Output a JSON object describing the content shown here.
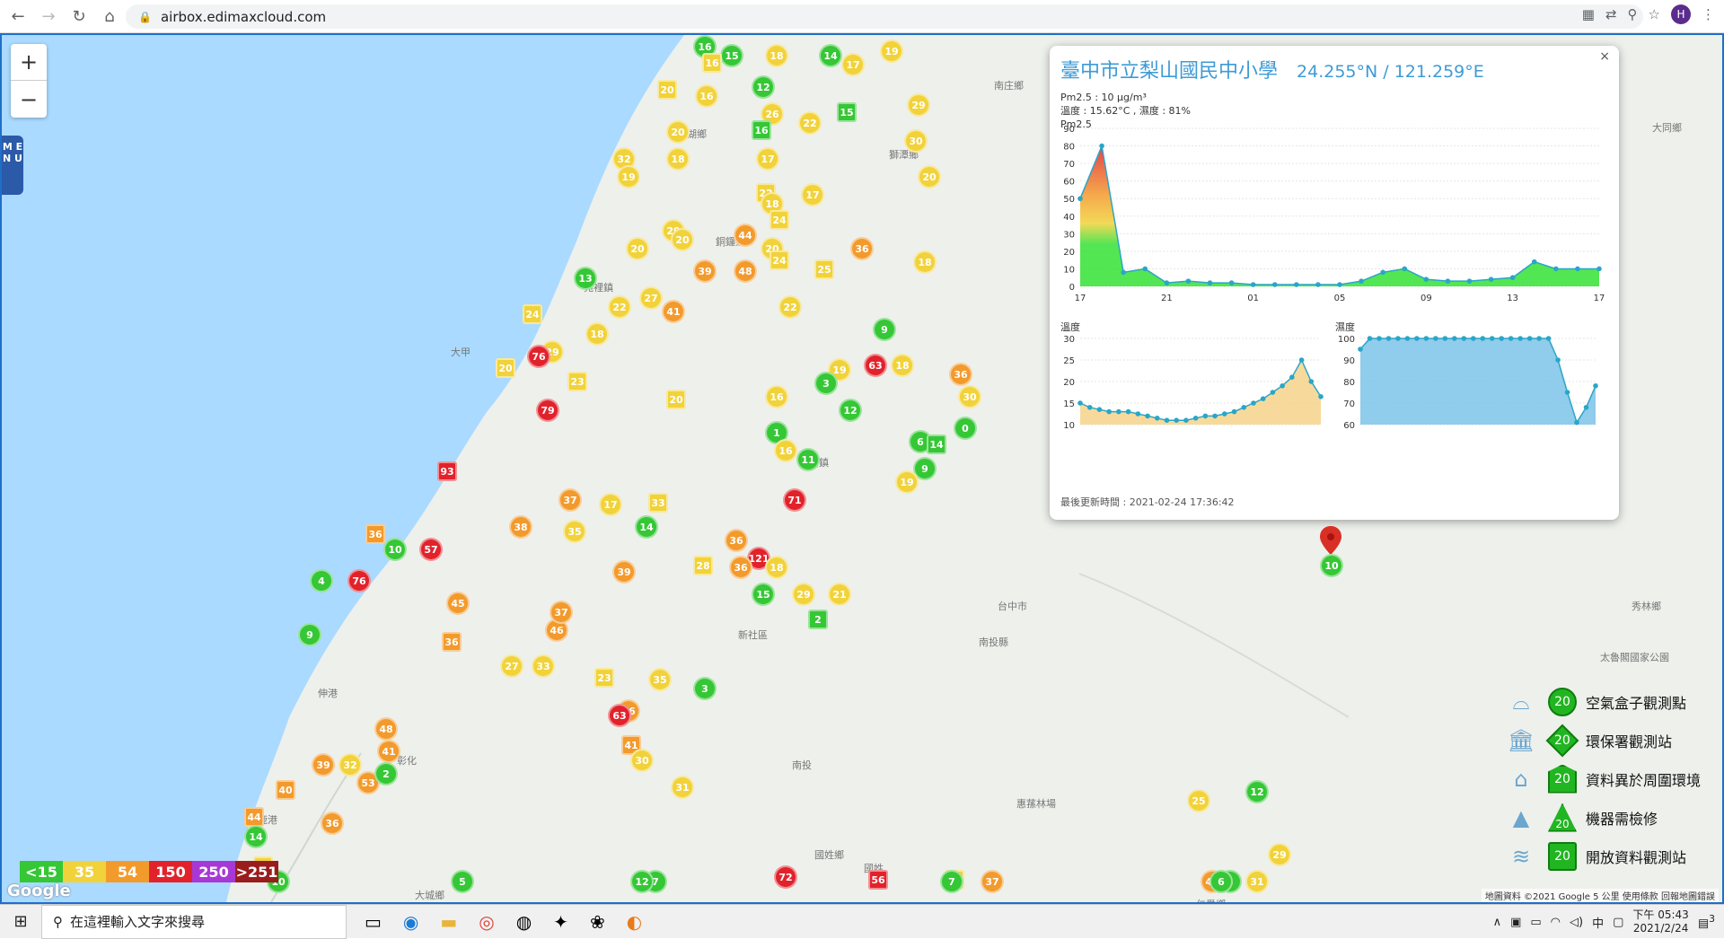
{
  "browser": {
    "url": "airbox.edimaxcloud.com",
    "avatar_letter": "H"
  },
  "map": {
    "zoom_in": "+",
    "zoom_out": "−",
    "menu_label": "M E N U",
    "places": [
      "南庄鄉",
      "大同鄉",
      "獅潭鄉",
      "西湖鄉",
      "銅鑼鄉",
      "苑裡鎮",
      "卓蘭鎮",
      "大甲",
      "台中市",
      "新社區",
      "南投縣",
      "惠蓀林場",
      "國姓鄉",
      "鹿港",
      "伸港",
      "秀林鄉",
      "太魯閣國家公園",
      "南投",
      "彰化",
      "大城鄉",
      "國姓",
      "仁愛鄉"
    ]
  },
  "popup": {
    "close": "×",
    "title": "臺中市立梨山國民中小學",
    "coord": "24.255°N / 121.259°E",
    "pm25_line": "Pm2.5 : 10 μg/m³",
    "temp_hum_line": "溫度 : 15.62°C , 濕度 : 81%",
    "pm25_label": "Pm2.5",
    "temp_label": "溫度",
    "hum_label": "濕度",
    "update": "最後更新時間 : 2021-02-24 17:36:42"
  },
  "chart_data": [
    {
      "type": "area",
      "title": "Pm2.5",
      "x": [
        "17",
        "18",
        "19",
        "20",
        "21",
        "22",
        "23",
        "00",
        "01",
        "02",
        "03",
        "04",
        "05",
        "06",
        "07",
        "08",
        "09",
        "10",
        "11",
        "12",
        "13",
        "14",
        "15",
        "16",
        "17"
      ],
      "tick_labels": [
        "17",
        "21",
        "01",
        "05",
        "09",
        "13",
        "17"
      ],
      "values": [
        50,
        80,
        8,
        10,
        2,
        3,
        2,
        2,
        1,
        1,
        1,
        1,
        1,
        3,
        8,
        10,
        4,
        3,
        3,
        4,
        5,
        14,
        10,
        10,
        10
      ],
      "ylim": [
        0,
        90
      ],
      "yticks": [
        0,
        10,
        20,
        30,
        40,
        50,
        60,
        70,
        80,
        90
      ]
    },
    {
      "type": "area",
      "title": "溫度",
      "values": [
        15,
        14,
        13.5,
        13,
        13,
        13,
        12.5,
        12,
        11.5,
        11,
        11,
        11,
        11.5,
        12,
        12,
        12.5,
        13,
        14,
        15,
        16,
        17.5,
        19,
        21,
        25,
        20,
        16.5
      ],
      "ylim": [
        10,
        30
      ],
      "yticks": [
        10,
        15,
        20,
        25,
        30
      ]
    },
    {
      "type": "area",
      "title": "濕度",
      "values": [
        95,
        100,
        100,
        100,
        100,
        100,
        100,
        100,
        100,
        100,
        100,
        100,
        100,
        100,
        100,
        100,
        100,
        100,
        100,
        100,
        100,
        90,
        75,
        61,
        68,
        78
      ],
      "ylim": [
        60,
        100
      ],
      "yticks": [
        60,
        70,
        80,
        90,
        100
      ]
    }
  ],
  "legend": [
    {
      "badge": "20",
      "label": "空氣盒子觀測點"
    },
    {
      "badge": "20",
      "label": "環保署觀測站"
    },
    {
      "badge": "20",
      "label": "資料異於周圍環境"
    },
    {
      "badge": "20",
      "label": "機器需檢修"
    },
    {
      "badge": "20",
      "label": "開放資料觀測站"
    }
  ],
  "scale": [
    {
      "label": "<15",
      "color": "#35c735"
    },
    {
      "label": "35",
      "color": "#f1d23a"
    },
    {
      "label": "54",
      "color": "#f39a2c"
    },
    {
      "label": "150",
      "color": "#e2222b"
    },
    {
      "label": "250",
      "color": "#a838d6"
    },
    {
      "label": ">251",
      "color": "#9a1d1d"
    }
  ],
  "google": "Google",
  "attrib": "地圖資料 ©2021 Google   5 公里        使用條款   回報地圖錯誤",
  "markers": [
    {
      "v": "16",
      "c": "#35c735"
    },
    {
      "v": "15",
      "c": "#35c735"
    },
    {
      "v": "16",
      "c": "#f1d23a"
    },
    {
      "v": "18",
      "c": "#f1d23a"
    },
    {
      "v": "14",
      "c": "#35c735"
    },
    {
      "v": "17",
      "c": "#f1d23a"
    },
    {
      "v": "19",
      "c": "#f1d23a"
    },
    {
      "v": "20",
      "c": "#f1d23a"
    },
    {
      "v": "16",
      "c": "#f1d23a"
    },
    {
      "v": "12",
      "c": "#35c735"
    },
    {
      "v": "26",
      "c": "#f1d23a"
    },
    {
      "v": "22",
      "c": "#f1d23a"
    },
    {
      "v": "15",
      "c": "#35c735"
    },
    {
      "v": "32",
      "c": "#f1d23a"
    },
    {
      "v": "20",
      "c": "#f1d23a"
    },
    {
      "v": "19",
      "c": "#f1d23a"
    },
    {
      "v": "18",
      "c": "#f1d23a"
    },
    {
      "v": "16",
      "c": "#35c735"
    },
    {
      "v": "17",
      "c": "#f1d23a"
    },
    {
      "v": "29",
      "c": "#f1d23a"
    },
    {
      "v": "30",
      "c": "#f1d23a"
    },
    {
      "v": "20",
      "c": "#f1d23a"
    },
    {
      "v": "22",
      "c": "#f1d23a"
    },
    {
      "v": "17",
      "c": "#f1d23a"
    },
    {
      "v": "29",
      "c": "#f1d23a"
    },
    {
      "v": "20",
      "c": "#f1d23a"
    },
    {
      "v": "18",
      "c": "#f1d23a"
    },
    {
      "v": "24",
      "c": "#f1d23a"
    },
    {
      "v": "20",
      "c": "#f1d23a"
    },
    {
      "v": "39",
      "c": "#f39a2c"
    },
    {
      "v": "44",
      "c": "#f39a2c"
    },
    {
      "v": "20",
      "c": "#f1d23a"
    },
    {
      "v": "24",
      "c": "#f1d23a"
    },
    {
      "v": "48",
      "c": "#f39a2c"
    },
    {
      "v": "36",
      "c": "#f39a2c"
    },
    {
      "v": "18",
      "c": "#f1d23a"
    },
    {
      "v": "22",
      "c": "#f1d23a"
    },
    {
      "v": "25",
      "c": "#f1d23a"
    },
    {
      "v": "13",
      "c": "#35c735"
    },
    {
      "v": "22",
      "c": "#f1d23a"
    },
    {
      "v": "27",
      "c": "#f1d23a"
    },
    {
      "v": "41",
      "c": "#f39a2c"
    },
    {
      "v": "24",
      "c": "#f1d23a"
    },
    {
      "v": "29",
      "c": "#f1d23a"
    },
    {
      "v": "18",
      "c": "#f1d23a"
    },
    {
      "v": "79",
      "c": "#e2222b"
    },
    {
      "v": "76",
      "c": "#e2222b"
    },
    {
      "v": "23",
      "c": "#f1d23a"
    },
    {
      "v": "19",
      "c": "#f1d23a"
    },
    {
      "v": "9",
      "c": "#35c735"
    },
    {
      "v": "63",
      "c": "#e2222b"
    },
    {
      "v": "18",
      "c": "#f1d23a"
    },
    {
      "v": "20",
      "c": "#f1d23a"
    },
    {
      "v": "12",
      "c": "#35c735"
    },
    {
      "v": "3",
      "c": "#35c735"
    },
    {
      "v": "30",
      "c": "#f1d23a"
    },
    {
      "v": "0",
      "c": "#35c735"
    },
    {
      "v": "20",
      "c": "#f1d23a"
    },
    {
      "v": "36",
      "c": "#f39a2c"
    },
    {
      "v": "1",
      "c": "#35c735"
    },
    {
      "v": "16",
      "c": "#f1d23a"
    },
    {
      "v": "6",
      "c": "#35c735"
    },
    {
      "v": "14",
      "c": "#35c735"
    },
    {
      "v": "16",
      "c": "#f1d23a"
    },
    {
      "v": "9",
      "c": "#35c735"
    },
    {
      "v": "11",
      "c": "#35c735"
    },
    {
      "v": "19",
      "c": "#f1d23a"
    },
    {
      "v": "93",
      "c": "#e2222b"
    },
    {
      "v": "71",
      "c": "#e2222b"
    },
    {
      "v": "37",
      "c": "#f39a2c"
    },
    {
      "v": "35",
      "c": "#f1d23a"
    },
    {
      "v": "17",
      "c": "#f1d23a"
    },
    {
      "v": "33",
      "c": "#f1d23a"
    },
    {
      "v": "14",
      "c": "#35c735"
    },
    {
      "v": "38",
      "c": "#f39a2c"
    },
    {
      "v": "36",
      "c": "#f39a2c"
    },
    {
      "v": "121",
      "c": "#e2222b"
    },
    {
      "v": "36",
      "c": "#f39a2c"
    },
    {
      "v": "10",
      "c": "#35c735"
    },
    {
      "v": "57",
      "c": "#e2222b"
    },
    {
      "v": "39",
      "c": "#f39a2c"
    },
    {
      "v": "36",
      "c": "#f39a2c"
    },
    {
      "v": "28",
      "c": "#f1d23a"
    },
    {
      "v": "18",
      "c": "#f1d23a"
    },
    {
      "v": "15",
      "c": "#35c735"
    },
    {
      "v": "29",
      "c": "#f1d23a"
    },
    {
      "v": "21",
      "c": "#f1d23a"
    },
    {
      "v": "2",
      "c": "#35c735"
    },
    {
      "v": "4",
      "c": "#35c735"
    },
    {
      "v": "76",
      "c": "#e2222b"
    },
    {
      "v": "45",
      "c": "#f39a2c"
    },
    {
      "v": "9",
      "c": "#35c735"
    },
    {
      "v": "36",
      "c": "#f39a2c"
    },
    {
      "v": "46",
      "c": "#f39a2c"
    },
    {
      "v": "37",
      "c": "#f39a2c"
    },
    {
      "v": "33",
      "c": "#f1d23a"
    },
    {
      "v": "27",
      "c": "#f1d23a"
    },
    {
      "v": "23",
      "c": "#f1d23a"
    },
    {
      "v": "35",
      "c": "#f1d23a"
    },
    {
      "v": "3",
      "c": "#35c735"
    },
    {
      "v": "36",
      "c": "#f39a2c"
    },
    {
      "v": "63",
      "c": "#e2222b"
    },
    {
      "v": "41",
      "c": "#f39a2c"
    },
    {
      "v": "30",
      "c": "#f1d23a"
    },
    {
      "v": "31",
      "c": "#f1d23a"
    },
    {
      "v": "32",
      "c": "#f1d23a"
    },
    {
      "v": "53",
      "c": "#f39a2c"
    },
    {
      "v": "44",
      "c": "#f39a2c"
    },
    {
      "v": "48",
      "c": "#f39a2c"
    },
    {
      "v": "41",
      "c": "#f39a2c"
    },
    {
      "v": "39",
      "c": "#f39a2c"
    },
    {
      "v": "2",
      "c": "#35c735"
    },
    {
      "v": "40",
      "c": "#f39a2c"
    },
    {
      "v": "36",
      "c": "#f39a2c"
    },
    {
      "v": "25",
      "c": "#f1d23a"
    },
    {
      "v": "12",
      "c": "#35c735"
    },
    {
      "v": "72",
      "c": "#e2222b"
    },
    {
      "v": "56",
      "c": "#e2222b"
    },
    {
      "v": "37",
      "c": "#f39a2c"
    },
    {
      "v": "29",
      "c": "#f1d23a"
    },
    {
      "v": "31",
      "c": "#f1d23a"
    },
    {
      "v": "14",
      "c": "#35c735"
    },
    {
      "v": "26",
      "c": "#f1d23a"
    },
    {
      "v": "10",
      "c": "#35c735"
    },
    {
      "v": "5",
      "c": "#35c735"
    },
    {
      "v": "7",
      "c": "#35c735"
    },
    {
      "v": "12",
      "c": "#35c735"
    },
    {
      "v": "28",
      "c": "#f1d23a"
    },
    {
      "v": "43",
      "c": "#f39a2c"
    },
    {
      "v": "5",
      "c": "#35c735"
    },
    {
      "v": "6",
      "c": "#35c735"
    },
    {
      "v": "7",
      "c": "#35c735"
    }
  ],
  "taskbar": {
    "search_placeholder": "在這裡輸入文字來搜尋",
    "tray_lang": "中",
    "time": "下午 05:43",
    "date": "2021/2/24",
    "notif": "3"
  }
}
